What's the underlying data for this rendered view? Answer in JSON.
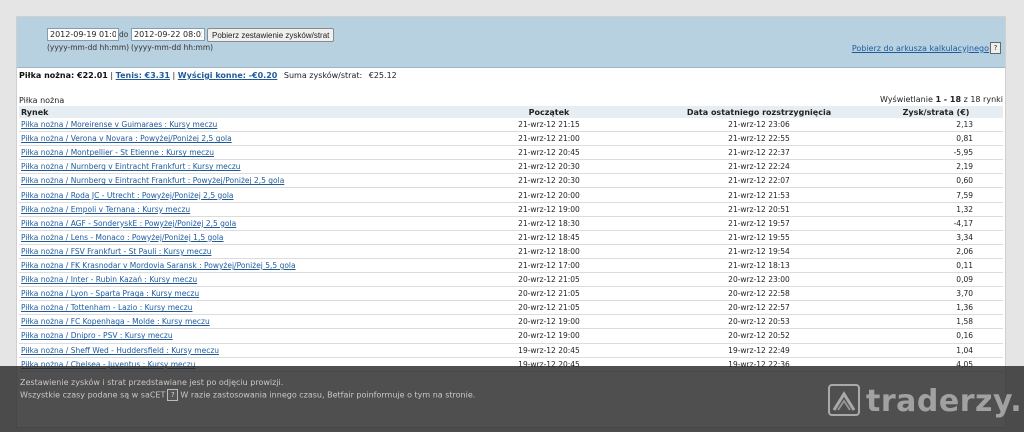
{
  "filters": {
    "from_value": "2012-09-19 01:00",
    "from_hint": "(yyyy-mm-dd hh:mm)",
    "to_label": "do",
    "to_value": "2012-09-22 08:05",
    "to_hint": "(yyyy-mm-dd hh:mm)",
    "fetch_button": "Pobierz zestawienie zysków/strat",
    "export_link": "Pobierz do arkusza kalkulacyjnego",
    "help_icon": "?"
  },
  "summary": {
    "football_label": "Piłka nożna: €22.01",
    "tennis_link": "Tenis: €3.31",
    "racing_link": "Wyścigi konne: -€0.20",
    "total_label": "Suma zysków/strat:",
    "total_value": "€25.12"
  },
  "section_title": "Piłka nożna",
  "paging": {
    "prefix": "Wyświetlanie",
    "range": "1 - 18",
    "suffix": "z 18 rynki"
  },
  "table": {
    "headers": [
      "Rynek",
      "Początek",
      "Data ostatniego rozstrzygnięcia",
      "Zysk/strata (€)"
    ],
    "rows": [
      [
        "Piłka nożna / Moreirense v Guimaraes : Kursy meczu",
        "21-wrz-12 21:15",
        "21-wrz-12 23:06",
        "2,13"
      ],
      [
        "Piłka nożna / Verona v Novara : Powyżej/Poniżej 2,5 gola",
        "21-wrz-12 21:00",
        "21-wrz-12 22:55",
        "0,81"
      ],
      [
        "Piłka nożna / Montpellier - St Etienne : Kursy meczu",
        "21-wrz-12 20:45",
        "21-wrz-12 22:37",
        "-5,95"
      ],
      [
        "Piłka nożna / Nurnberg v Eintracht Frankfurt : Kursy meczu",
        "21-wrz-12 20:30",
        "21-wrz-12 22:24",
        "2,19"
      ],
      [
        "Piłka nożna / Nurnberg v Eintracht Frankfurt : Powyżej/Poniżej 2,5 gola",
        "21-wrz-12 20:30",
        "21-wrz-12 22:07",
        "0,60"
      ],
      [
        "Piłka nożna / Roda JC - Utrecht : Powyżej/Poniżej 2,5 gola",
        "21-wrz-12 20:00",
        "21-wrz-12 21:53",
        "7,59"
      ],
      [
        "Piłka nożna / Empoli v Ternana : Kursy meczu",
        "21-wrz-12 19:00",
        "21-wrz-12 20:51",
        "1,32"
      ],
      [
        "Piłka nożna / AGF - SonderyskE : Powyżej/Poniżej 2,5 gola",
        "21-wrz-12 18:30",
        "21-wrz-12 19:57",
        "-4,17"
      ],
      [
        "Piłka nożna / Lens - Monaco : Powyżej/Poniżej 1,5 gola",
        "21-wrz-12 18:45",
        "21-wrz-12 19:55",
        "3,34"
      ],
      [
        "Piłka nożna / FSV Frankfurt - St Pauli : Kursy meczu",
        "21-wrz-12 18:00",
        "21-wrz-12 19:54",
        "2,06"
      ],
      [
        "Piłka nożna / FK Krasnodar v Mordovia Saransk : Powyżej/Poniżej 5,5 gola",
        "21-wrz-12 17:00",
        "21-wrz-12 18:13",
        "0,11"
      ],
      [
        "Piłka nożna / Inter - Rubin Kazań : Kursy meczu",
        "20-wrz-12 21:05",
        "20-wrz-12 23:00",
        "0,09"
      ],
      [
        "Piłka nożna / Lyon - Sparta Praga : Kursy meczu",
        "20-wrz-12 21:05",
        "20-wrz-12 22:58",
        "3,70"
      ],
      [
        "Piłka nożna / Tottenham - Lazio : Kursy meczu",
        "20-wrz-12 21:05",
        "20-wrz-12 22:57",
        "1,36"
      ],
      [
        "Piłka nożna / FC Kopenhaga - Molde : Kursy meczu",
        "20-wrz-12 19:00",
        "20-wrz-12 20:53",
        "1,58"
      ],
      [
        "Piłka nożna / Dnipro - PSV : Kursy meczu",
        "20-wrz-12 19:00",
        "20-wrz-12 20:52",
        "0,16"
      ],
      [
        "Piłka nożna / Sheff Wed - Huddersfield : Kursy meczu",
        "19-wrz-12 20:45",
        "19-wrz-12 22:49",
        "1,04"
      ],
      [
        "Piłka nożna / Chelsea - Juventus : Kursy meczu",
        "19-wrz-12 20:45",
        "19-wrz-12 22:36",
        "4,05"
      ]
    ]
  },
  "notes": {
    "line1": "Zestawienie zysków i strat przedstawiane jest po odjęciu prowizji.",
    "line2_prefix": "Wszystkie czasy podane są w saCET",
    "line2_suffix": "W razie zastosowania innego czasu, Betfair poinformuje o tym na stronie."
  },
  "watermark": {
    "text": "traderzy.pl"
  }
}
